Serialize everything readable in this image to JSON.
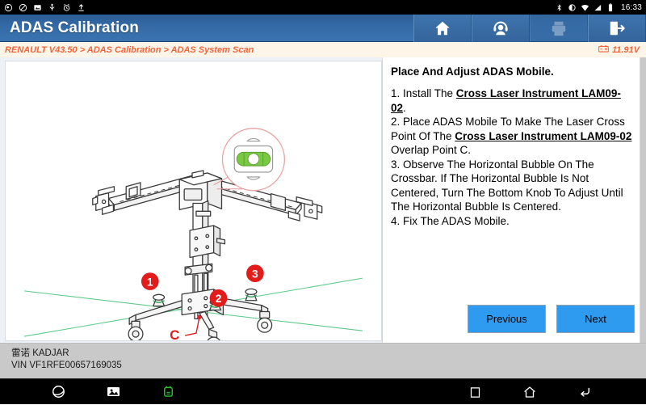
{
  "statusbar": {
    "left_icons": [
      {
        "name": "notification-icon"
      },
      {
        "name": "do-not-disturb-icon"
      },
      {
        "name": "screenshot-icon"
      },
      {
        "name": "usb-icon"
      },
      {
        "name": "alarm-icon"
      },
      {
        "name": "upload-icon"
      }
    ],
    "right_icons": [
      {
        "name": "bluetooth-icon"
      },
      {
        "name": "brightness-icon"
      },
      {
        "name": "wifi-icon"
      },
      {
        "name": "signal-icon"
      },
      {
        "name": "battery-icon"
      }
    ],
    "time": "16:33"
  },
  "titlebar": {
    "title": "ADAS Calibration",
    "buttons": [
      {
        "name": "home-icon",
        "label": "Home"
      },
      {
        "name": "support-headset-icon",
        "label": "Support"
      },
      {
        "name": "printer-icon",
        "label": "Print"
      },
      {
        "name": "exit-icon",
        "label": "Exit"
      }
    ]
  },
  "breadcrumb": {
    "path": "RENAULT V43.50 > ADAS Calibration > ADAS System Scan",
    "voltage": "11.91V",
    "voltage_icon": "battery-voltage-icon"
  },
  "illustration": {
    "name": "adas-mobile-calibration-frame-diagram",
    "bubble_level_color": "#7ac943",
    "callout_color": "#e8a0a0",
    "laser_color": "#5fc98a",
    "markers": [
      "1",
      "2",
      "3"
    ],
    "point_label": "C"
  },
  "instructions": {
    "title": "Place And Adjust ADAS Mobile.",
    "steps": [
      {
        "prefix": "1. Install The ",
        "highlight": "Cross Laser Instrument LAM09-02",
        "suffix": "."
      },
      {
        "prefix": "2. Place ADAS Mobile To Make The Laser Cross Point Of The ",
        "highlight": "Cross Laser Instrument LAM09-02",
        "suffix": " Overlap Point C."
      },
      {
        "prefix": "3. Observe The Horizontal Bubble On The Crossbar. If The Horizontal Bubble Is Not Centered, Turn The Bottom Knob To Adjust Until The Horizontal Bubble Is Centered.",
        "highlight": "",
        "suffix": ""
      },
      {
        "prefix": "4. Fix The ADAS Mobile.",
        "highlight": "",
        "suffix": ""
      }
    ]
  },
  "actions": {
    "previous_label": "Previous",
    "next_label": "Next"
  },
  "vehicle": {
    "model": "雷诺 KADJAR",
    "vin": "VIN VF1RFE00657169035"
  },
  "navbar": {
    "left": [
      {
        "name": "browser-icon"
      },
      {
        "name": "gallery-icon"
      },
      {
        "name": "vci-connector-icon"
      }
    ],
    "right": [
      {
        "name": "recents-square-icon"
      },
      {
        "name": "home-icon"
      },
      {
        "name": "back-icon"
      }
    ],
    "vci_color": "#26c335"
  },
  "colors": {
    "title_blue": "#336aa6",
    "accent_orange": "#f4633a",
    "button_blue": "#2e9bf0",
    "crumb_bg": "#fdf6e8"
  }
}
